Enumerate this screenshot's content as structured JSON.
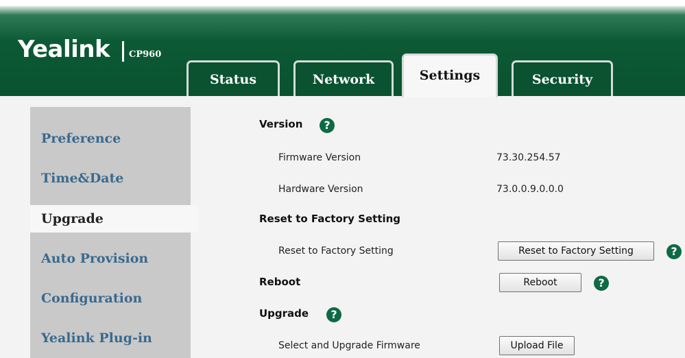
{
  "header": {
    "brand": "Yealink",
    "model": "CP960",
    "tabs": [
      {
        "label": "Status",
        "active": false
      },
      {
        "label": "Network",
        "active": false
      },
      {
        "label": "Settings",
        "active": true
      },
      {
        "label": "Security",
        "active": false
      }
    ]
  },
  "sidebar": {
    "items": [
      {
        "label": "Preference",
        "active": false
      },
      {
        "label": "Time&Date",
        "active": false
      },
      {
        "label": "Upgrade",
        "active": true
      },
      {
        "label": "Auto Provision",
        "active": false
      },
      {
        "label": "Configuration",
        "active": false
      },
      {
        "label": "Yealink Plug-in",
        "active": false
      }
    ]
  },
  "main": {
    "version": {
      "title": "Version",
      "firmware_label": "Firmware Version",
      "firmware_value": "73.30.254.57",
      "hardware_label": "Hardware Version",
      "hardware_value": "73.0.0.9.0.0.0"
    },
    "reset": {
      "title": "Reset to Factory Setting",
      "label": "Reset to Factory Setting",
      "button": "Reset to Factory Setting"
    },
    "reboot": {
      "title": "Reboot",
      "button": "Reboot"
    },
    "upgrade": {
      "title": "Upgrade",
      "label": "Select and Upgrade Firmware",
      "button": "Upload File"
    }
  },
  "icons": {
    "help": "question-mark-circle",
    "help_symbol": "?"
  },
  "colors": {
    "header_green": "#0a5230",
    "help_green": "#0e6a44",
    "sidebar_text": "#3a6a8e"
  }
}
